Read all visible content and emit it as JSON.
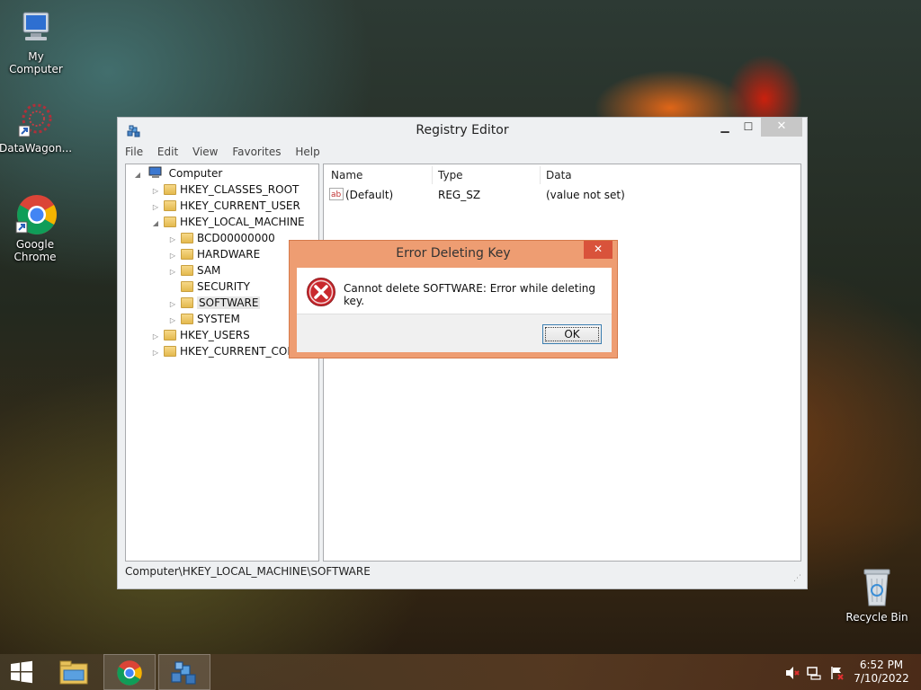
{
  "desktop": {
    "icons": [
      {
        "label": "My Computer"
      },
      {
        "label": "DataWagon..."
      },
      {
        "label": "Google Chrome"
      },
      {
        "label": "Recycle Bin"
      }
    ]
  },
  "window": {
    "title": "Registry Editor",
    "menu": [
      "File",
      "Edit",
      "View",
      "Favorites",
      "Help"
    ],
    "tree": [
      {
        "label": "Computer"
      },
      {
        "label": "HKEY_CLASSES_ROOT"
      },
      {
        "label": "HKEY_CURRENT_USER"
      },
      {
        "label": "HKEY_LOCAL_MACHINE"
      },
      {
        "label": "BCD00000000"
      },
      {
        "label": "HARDWARE"
      },
      {
        "label": "SAM"
      },
      {
        "label": "SECURITY"
      },
      {
        "label": "SOFTWARE"
      },
      {
        "label": "SYSTEM"
      },
      {
        "label": "HKEY_USERS"
      },
      {
        "label": "HKEY_CURRENT_CONFIG"
      }
    ],
    "list": {
      "columns": [
        "Name",
        "Type",
        "Data"
      ],
      "rows": [
        {
          "name": "(Default)",
          "type": "REG_SZ",
          "data": "(value not set)"
        }
      ]
    },
    "status": "Computer\\HKEY_LOCAL_MACHINE\\SOFTWARE"
  },
  "dialog": {
    "title": "Error Deleting Key",
    "message": "Cannot delete SOFTWARE:  Error while deleting key.",
    "ok_label": "OK",
    "close_glyph": "✕"
  },
  "taskbar": {
    "time": "6:52 PM",
    "date": "7/10/2022"
  },
  "colors": {
    "dialog_frame": "#ee9d72",
    "dialog_close": "#d9533b",
    "error_icon": "#c9282d"
  }
}
